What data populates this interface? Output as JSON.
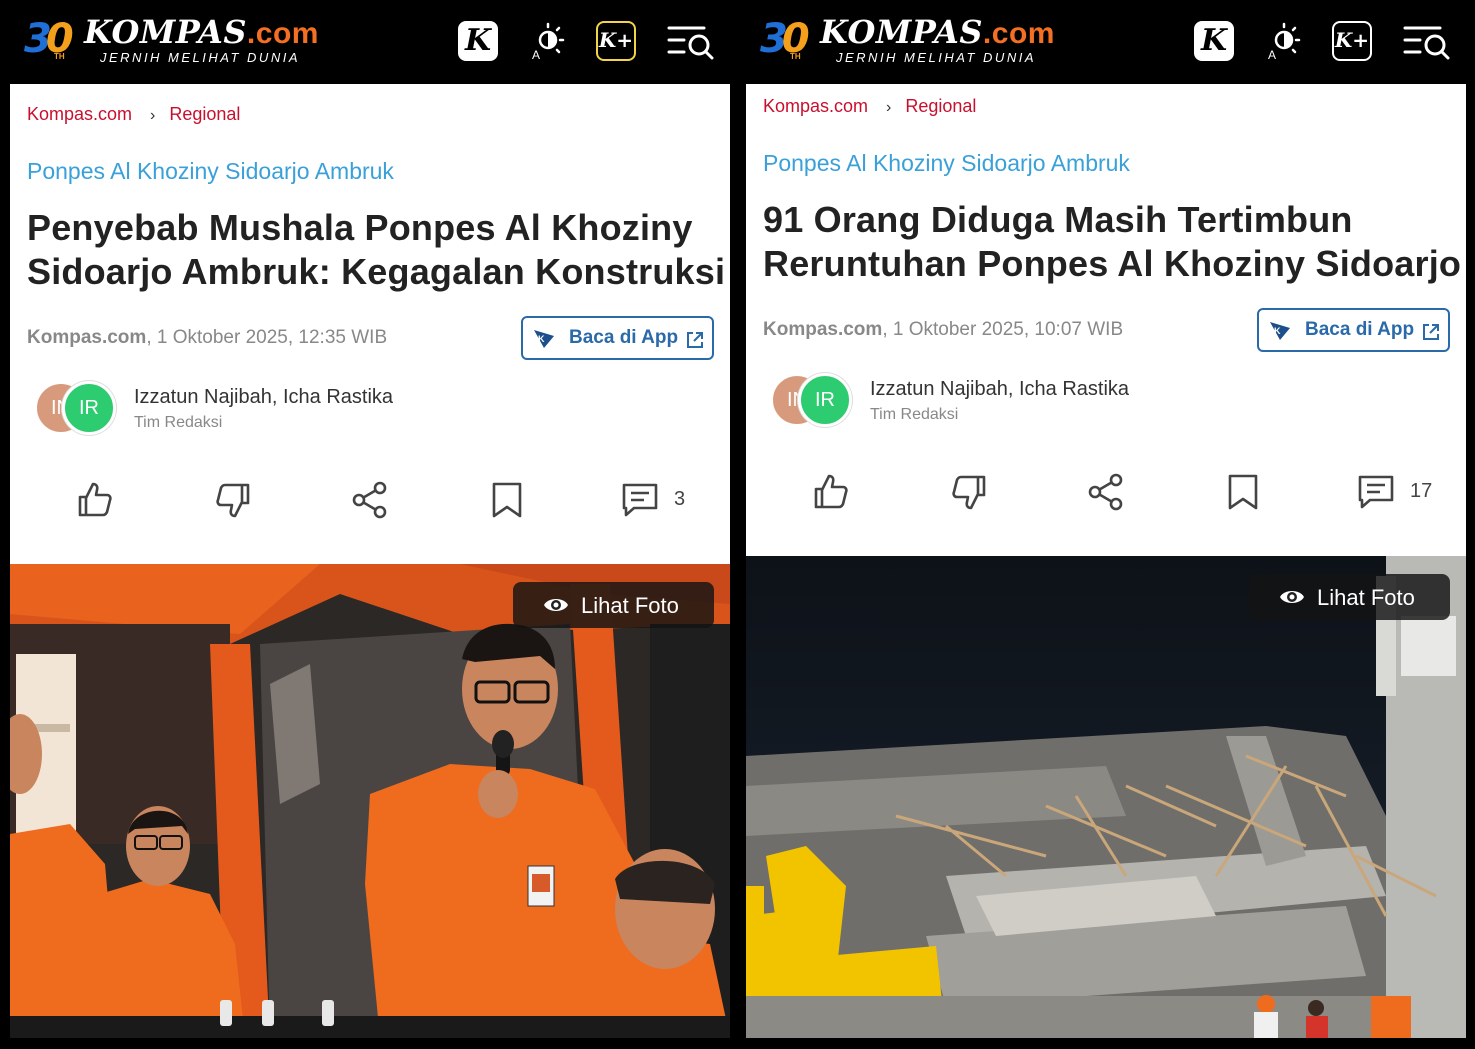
{
  "brand": {
    "anniversary": "30",
    "anniversary_suffix": "TH",
    "name": "KOMPAS",
    "domain": ".com",
    "tagline": "JERNIH MELIHAT DUNIA",
    "colors": {
      "accent": "#f36f21",
      "link": "#c8102e",
      "topic": "#3aa0d9",
      "button": "#2b6aa8"
    }
  },
  "toolbar": {
    "k_label": "K",
    "kplus_label": "K+",
    "icons": [
      "kompas-k-icon",
      "theme-toggle-icon",
      "kompas-plus-icon",
      "menu-search-icon"
    ]
  },
  "articles": [
    {
      "breadcrumb": [
        "Kompas.com",
        "Regional"
      ],
      "topic": "Ponpes Al Khoziny Sidoarjo Ambruk",
      "headline": "Penyebab Mushala Ponpes Al Khoziny Sidoarjo Ambruk: Kegagalan Konstruksi",
      "source": "Kompas.com",
      "date": ", 1 Oktober 2025, 12:35 WIB",
      "app_button": "Baca di App",
      "avatars": [
        "IN",
        "IR"
      ],
      "authors": "Izzatun Najibah,  Icha Rastika",
      "role": "Tim Redaksi",
      "comment_count": "3",
      "photo_button": "Lihat Foto"
    },
    {
      "breadcrumb": [
        "Kompas.com",
        "Regional"
      ],
      "topic": "Ponpes Al Khoziny Sidoarjo Ambruk",
      "headline": "91 Orang Diduga Masih Tertimbun Reruntuhan Ponpes Al Khoziny Sidoarjo",
      "source": "Kompas.com",
      "date": ", 1 Oktober 2025, 10:07 WIB",
      "app_button": "Baca di App",
      "avatars": [
        "IN",
        "IR"
      ],
      "authors": "Izzatun Najibah,  Icha Rastika",
      "role": "Tim Redaksi",
      "comment_count": "17",
      "photo_button": "Lihat Foto"
    }
  ]
}
